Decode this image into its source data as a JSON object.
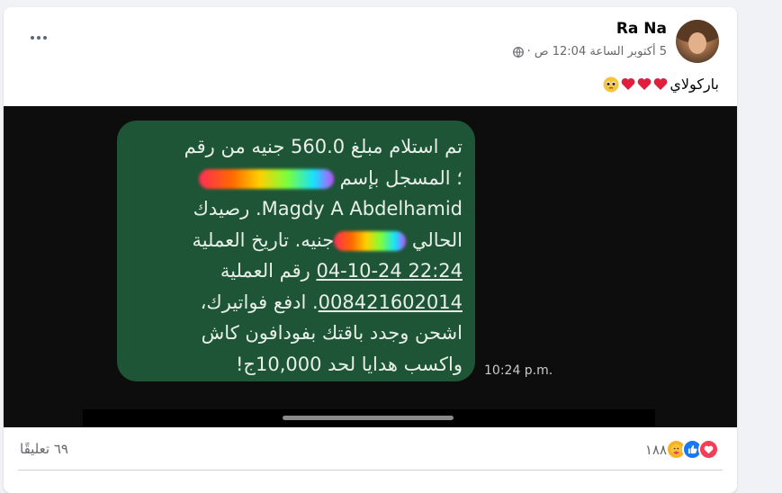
{
  "post": {
    "author": "Ra Na",
    "meta_text": "5 أكتوبر الساعة 12:04 ص ·",
    "caption_text": "باركولاي"
  },
  "photo": {
    "message_lines": [
      "تم استلام مبلغ 560.0 جنيه من رقم",
      "؛ المسجل بإسم",
      "Magdy A Abdelhamid. رصيدك",
      "الحالي",
      "جنيه. تاريخ العملية",
      "22:24 04-10-24",
      "رقم العملية",
      "008421602014",
      ". ادفع فواتيرك،",
      "اشحن وجدد باقتك بفودافون كاش",
      "واكسب هدايا لحد 10,000ج!"
    ],
    "timestamp": "10:24 p.m."
  },
  "footer": {
    "reaction_count": "١٨٨",
    "comment_count": "٦٩ تعليقًا"
  },
  "colors": {
    "bubble": "#1e5536",
    "reaction_like": "#1877f2",
    "reaction_love": "#f33e58",
    "reaction_care": "#f7b125"
  }
}
